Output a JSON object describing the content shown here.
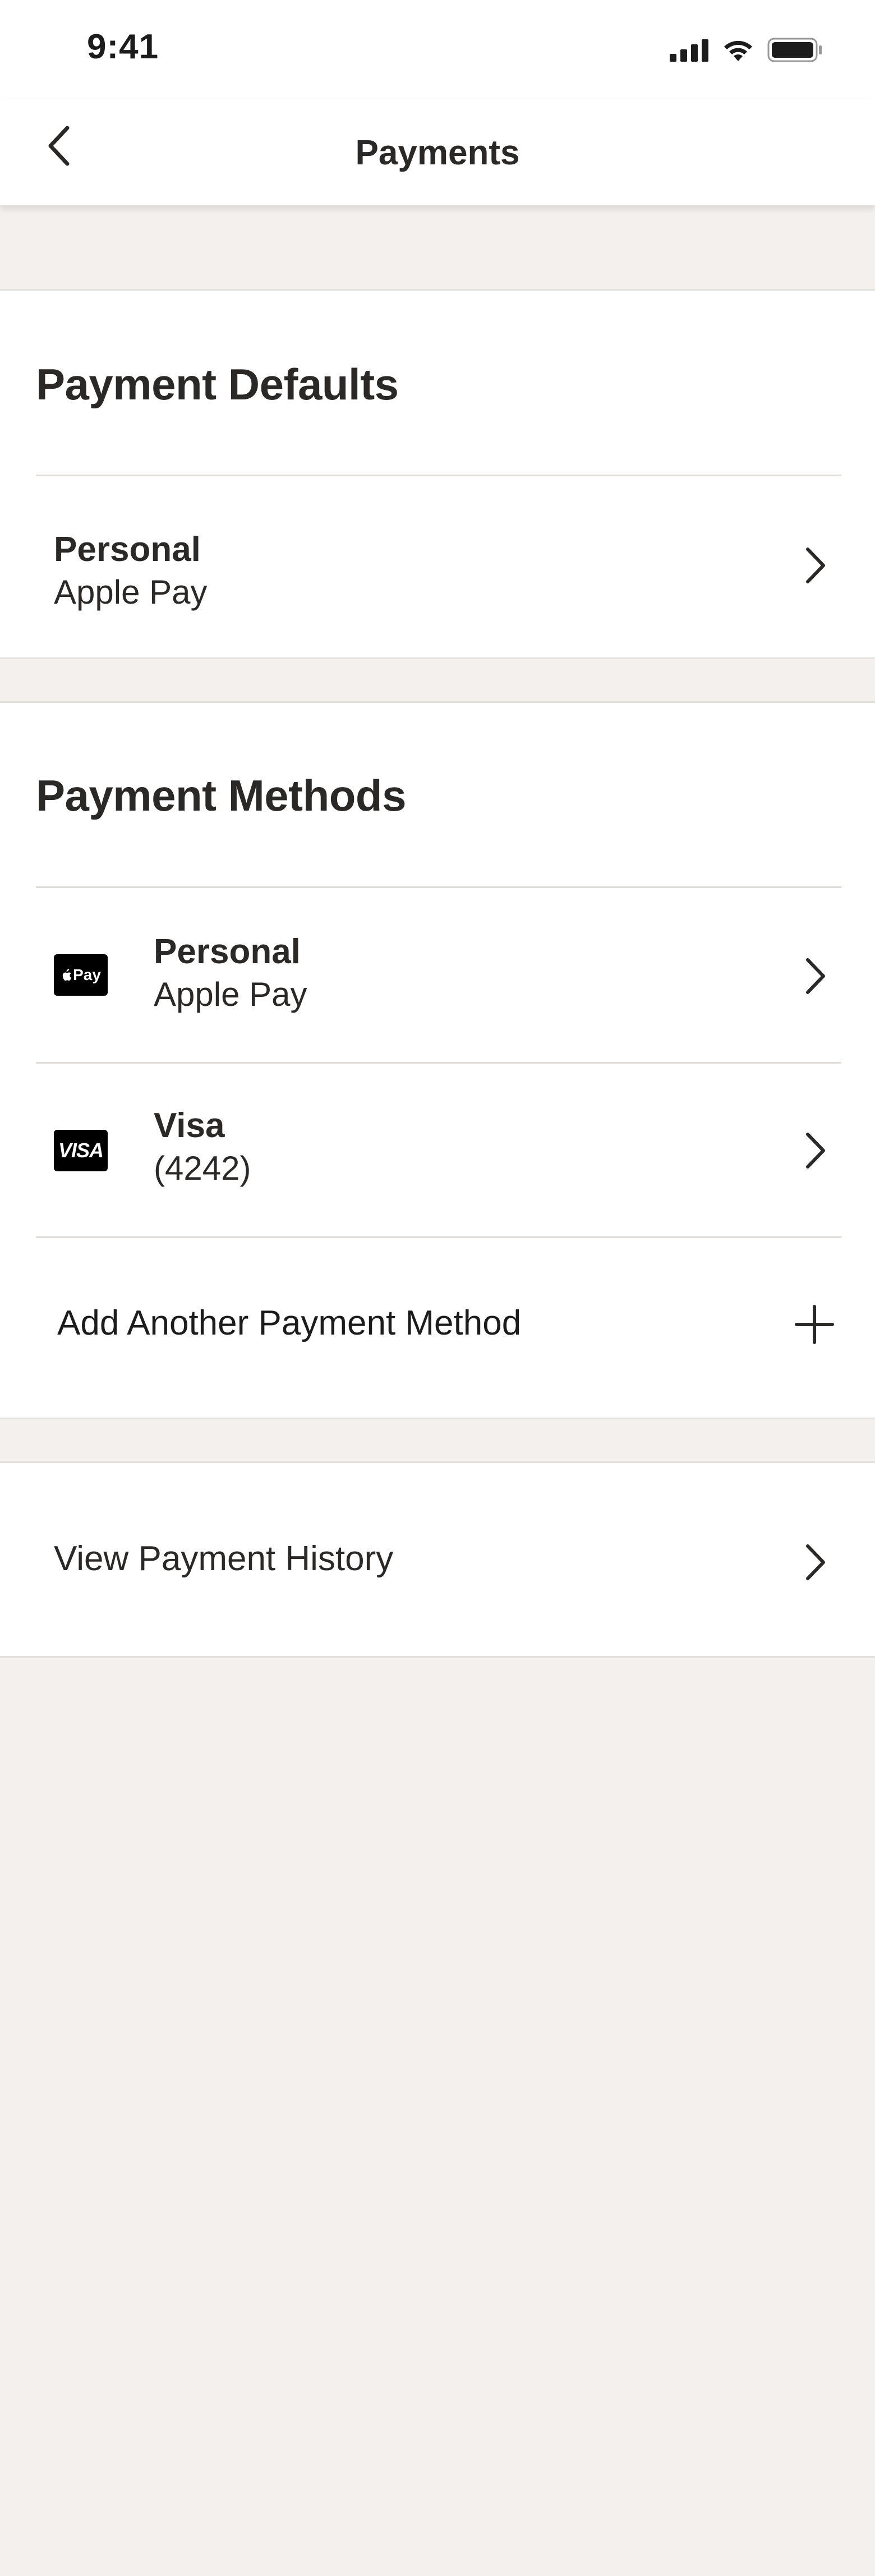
{
  "status_bar": {
    "time": "9:41",
    "icons": [
      "cellular-signal-icon",
      "wifi-icon",
      "battery-icon"
    ]
  },
  "nav": {
    "title": "Payments",
    "back_icon": "chevron-left-icon"
  },
  "payment_defaults": {
    "heading": "Payment Defaults",
    "items": [
      {
        "title": "Personal",
        "subtitle": "Apple Pay",
        "icon": "chevron-right-icon"
      }
    ]
  },
  "payment_methods": {
    "heading": "Payment Methods",
    "items": [
      {
        "title": "Personal",
        "subtitle": "Apple Pay",
        "logo_text": "Pay",
        "logo": "apple-pay-logo",
        "icon": "chevron-right-icon"
      },
      {
        "title": "Visa",
        "subtitle": "(4242)",
        "logo_text": "VISA",
        "logo": "visa-logo",
        "icon": "chevron-right-icon"
      }
    ],
    "add_label": "Add Another Payment Method",
    "add_icon": "plus-icon"
  },
  "history": {
    "label": "View Payment History",
    "icon": "chevron-right-icon"
  },
  "colors": {
    "background": "#f4f0ed",
    "card": "#ffffff",
    "divider": "#e0dcd9",
    "text": "#2b2928"
  }
}
